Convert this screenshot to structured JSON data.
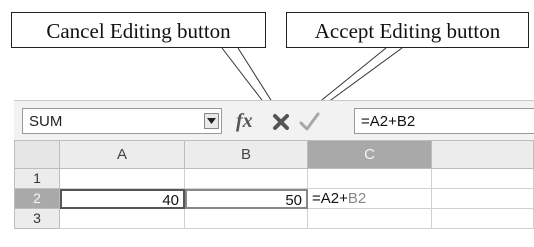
{
  "callouts": {
    "cancel_editing": "Cancel Editing button",
    "accept_editing": "Accept Editing button"
  },
  "formula_bar": {
    "name_box_value": "SUM",
    "function_wizard_label": "fx",
    "cancel_icon": "cancel-x-icon",
    "accept_icon": "accept-check-icon",
    "formula_value": "=A2+B2"
  },
  "grid": {
    "columns": [
      "A",
      "B",
      "C",
      ""
    ],
    "active_column": "C",
    "rows": [
      {
        "header": "1",
        "cells": [
          "",
          "",
          ""
        ]
      },
      {
        "header": "2",
        "cells": [
          "40",
          "50",
          ""
        ],
        "active": true,
        "formula_parts": [
          "=A2+",
          "B2"
        ]
      },
      {
        "header": "3",
        "cells": [
          "",
          "",
          ""
        ]
      }
    ]
  },
  "colors": {
    "active_header": "#a9a9a9",
    "reference_a_border": "#555555",
    "reference_b_border": "#888888"
  }
}
